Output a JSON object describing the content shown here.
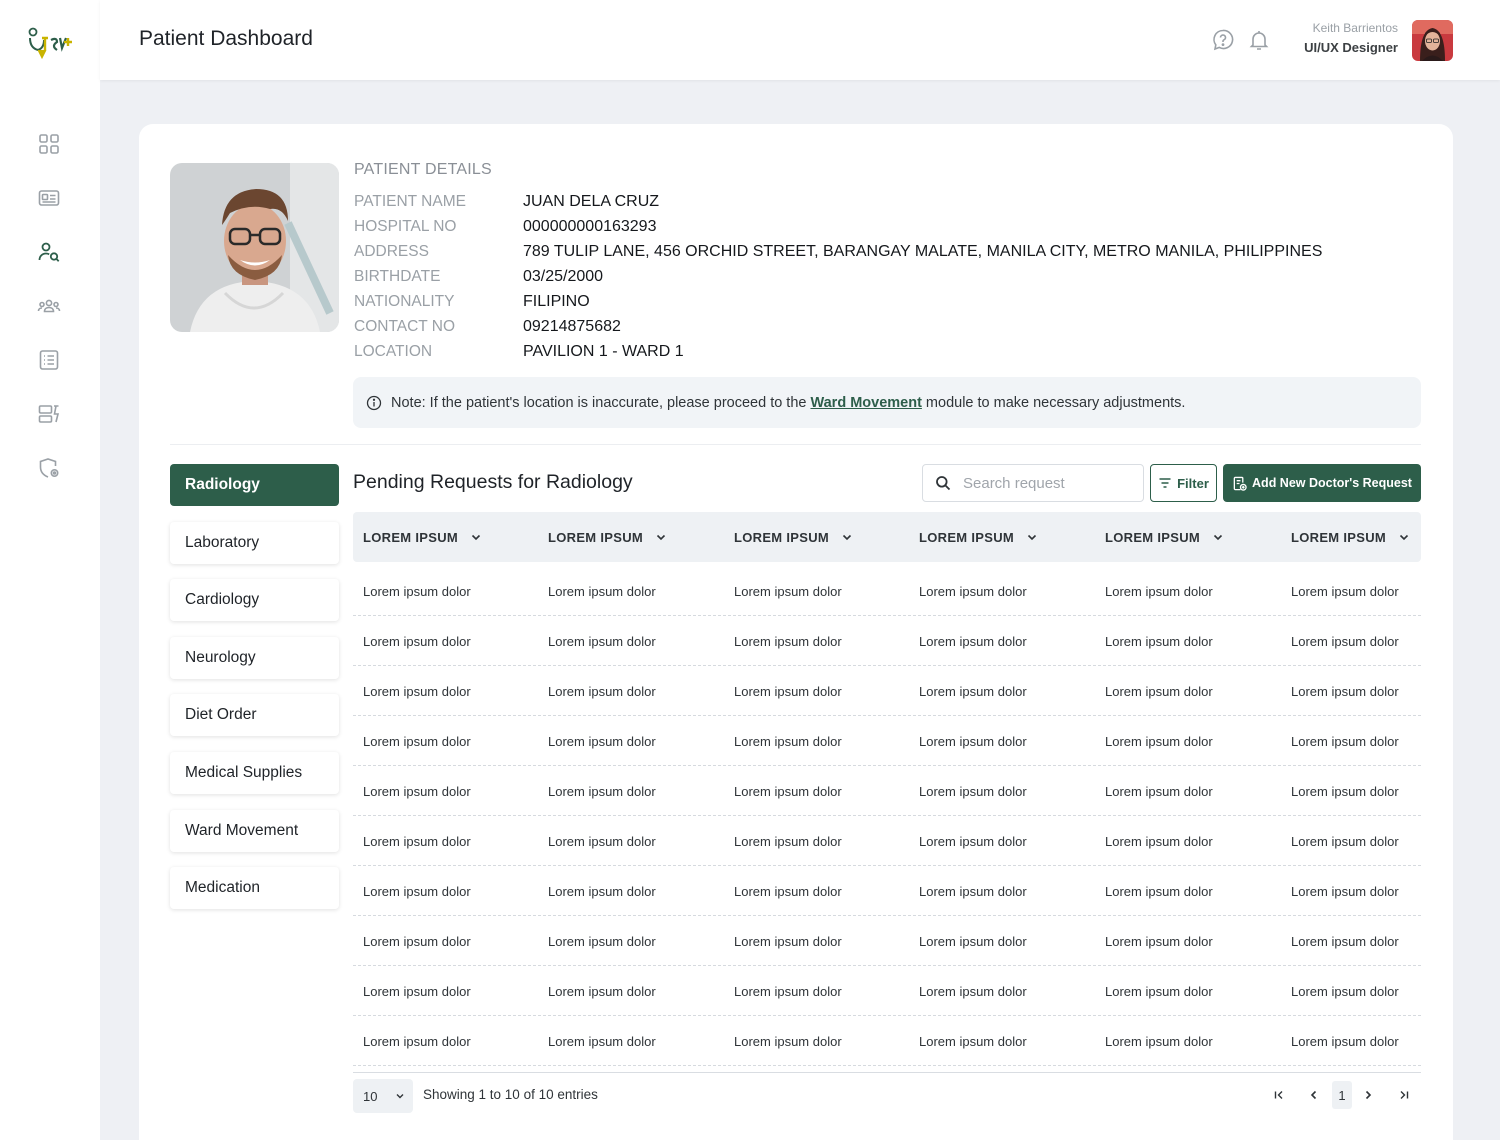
{
  "header": {
    "title": "Patient Dashboard",
    "user_name": "Keith Barrientos",
    "user_role": "UI/UX Designer"
  },
  "sidebar": {
    "items": [
      {
        "icon": "grid-icon"
      },
      {
        "icon": "id-card-icon"
      },
      {
        "icon": "patient-search-icon",
        "active": true
      },
      {
        "icon": "people-group-icon"
      },
      {
        "icon": "list-icon"
      },
      {
        "icon": "report-icon"
      },
      {
        "icon": "shield-settings-icon"
      }
    ]
  },
  "patient": {
    "section_title": "PATIENT DETAILS",
    "fields": [
      {
        "label": "PATIENT NAME",
        "value": "JUAN DELA CRUZ"
      },
      {
        "label": "HOSPITAL NO",
        "value": "000000000163293"
      },
      {
        "label": "ADDRESS",
        "value": "789 TULIP LANE, 456 ORCHID STREET, BARANGAY MALATE, MANILA CITY, METRO MANILA, PHILIPPINES"
      },
      {
        "label": "BIRTHDATE",
        "value": "03/25/2000"
      },
      {
        "label": "NATIONALITY",
        "value": "FILIPINO"
      },
      {
        "label": "CONTACT NO",
        "value": "09214875682"
      },
      {
        "label": "LOCATION",
        "value": "PAVILION 1 - WARD 1"
      }
    ]
  },
  "note": {
    "prefix": "Note: If the patient's location is inaccurate, please proceed to the",
    "link": "Ward Movement",
    "suffix": "module to make necessary adjustments."
  },
  "tabs": [
    {
      "label": "Radiology",
      "active": true
    },
    {
      "label": "Laboratory"
    },
    {
      "label": "Cardiology"
    },
    {
      "label": "Neurology"
    },
    {
      "label": "Diet Order"
    },
    {
      "label": "Medical Supplies"
    },
    {
      "label": "Ward Movement"
    },
    {
      "label": "Medication"
    }
  ],
  "requests": {
    "title": "Pending Requests for Radiology",
    "search_placeholder": "Search request",
    "filter_label": "Filter",
    "add_label": "Add New Doctor's Request",
    "columns": [
      "LOREM IPSUM",
      "LOREM IPSUM",
      "LOREM IPSUM",
      "LOREM IPSUM",
      "LOREM IPSUM",
      "LOREM IPSUM"
    ],
    "rows": [
      [
        "Lorem ipsum dolor",
        "Lorem ipsum dolor",
        "Lorem ipsum dolor",
        "Lorem ipsum dolor",
        "Lorem ipsum dolor",
        "Lorem ipsum dolor"
      ],
      [
        "Lorem ipsum dolor",
        "Lorem ipsum dolor",
        "Lorem ipsum dolor",
        "Lorem ipsum dolor",
        "Lorem ipsum dolor",
        "Lorem ipsum dolor"
      ],
      [
        "Lorem ipsum dolor",
        "Lorem ipsum dolor",
        "Lorem ipsum dolor",
        "Lorem ipsum dolor",
        "Lorem ipsum dolor",
        "Lorem ipsum dolor"
      ],
      [
        "Lorem ipsum dolor",
        "Lorem ipsum dolor",
        "Lorem ipsum dolor",
        "Lorem ipsum dolor",
        "Lorem ipsum dolor",
        "Lorem ipsum dolor"
      ],
      [
        "Lorem ipsum dolor",
        "Lorem ipsum dolor",
        "Lorem ipsum dolor",
        "Lorem ipsum dolor",
        "Lorem ipsum dolor",
        "Lorem ipsum dolor"
      ],
      [
        "Lorem ipsum dolor",
        "Lorem ipsum dolor",
        "Lorem ipsum dolor",
        "Lorem ipsum dolor",
        "Lorem ipsum dolor",
        "Lorem ipsum dolor"
      ],
      [
        "Lorem ipsum dolor",
        "Lorem ipsum dolor",
        "Lorem ipsum dolor",
        "Lorem ipsum dolor",
        "Lorem ipsum dolor",
        "Lorem ipsum dolor"
      ],
      [
        "Lorem ipsum dolor",
        "Lorem ipsum dolor",
        "Lorem ipsum dolor",
        "Lorem ipsum dolor",
        "Lorem ipsum dolor",
        "Lorem ipsum dolor"
      ],
      [
        "Lorem ipsum dolor",
        "Lorem ipsum dolor",
        "Lorem ipsum dolor",
        "Lorem ipsum dolor",
        "Lorem ipsum dolor",
        "Lorem ipsum dolor"
      ],
      [
        "Lorem ipsum dolor",
        "Lorem ipsum dolor",
        "Lorem ipsum dolor",
        "Lorem ipsum dolor",
        "Lorem ipsum dolor",
        "Lorem ipsum dolor"
      ]
    ]
  },
  "pagination": {
    "page_size": "10",
    "showing": "Showing 1 to 10 of 10 entries",
    "current_page": "1"
  },
  "colors": {
    "brand": "#2d5e4a",
    "background": "#eef0f4",
    "header_row": "#eef1f4"
  }
}
